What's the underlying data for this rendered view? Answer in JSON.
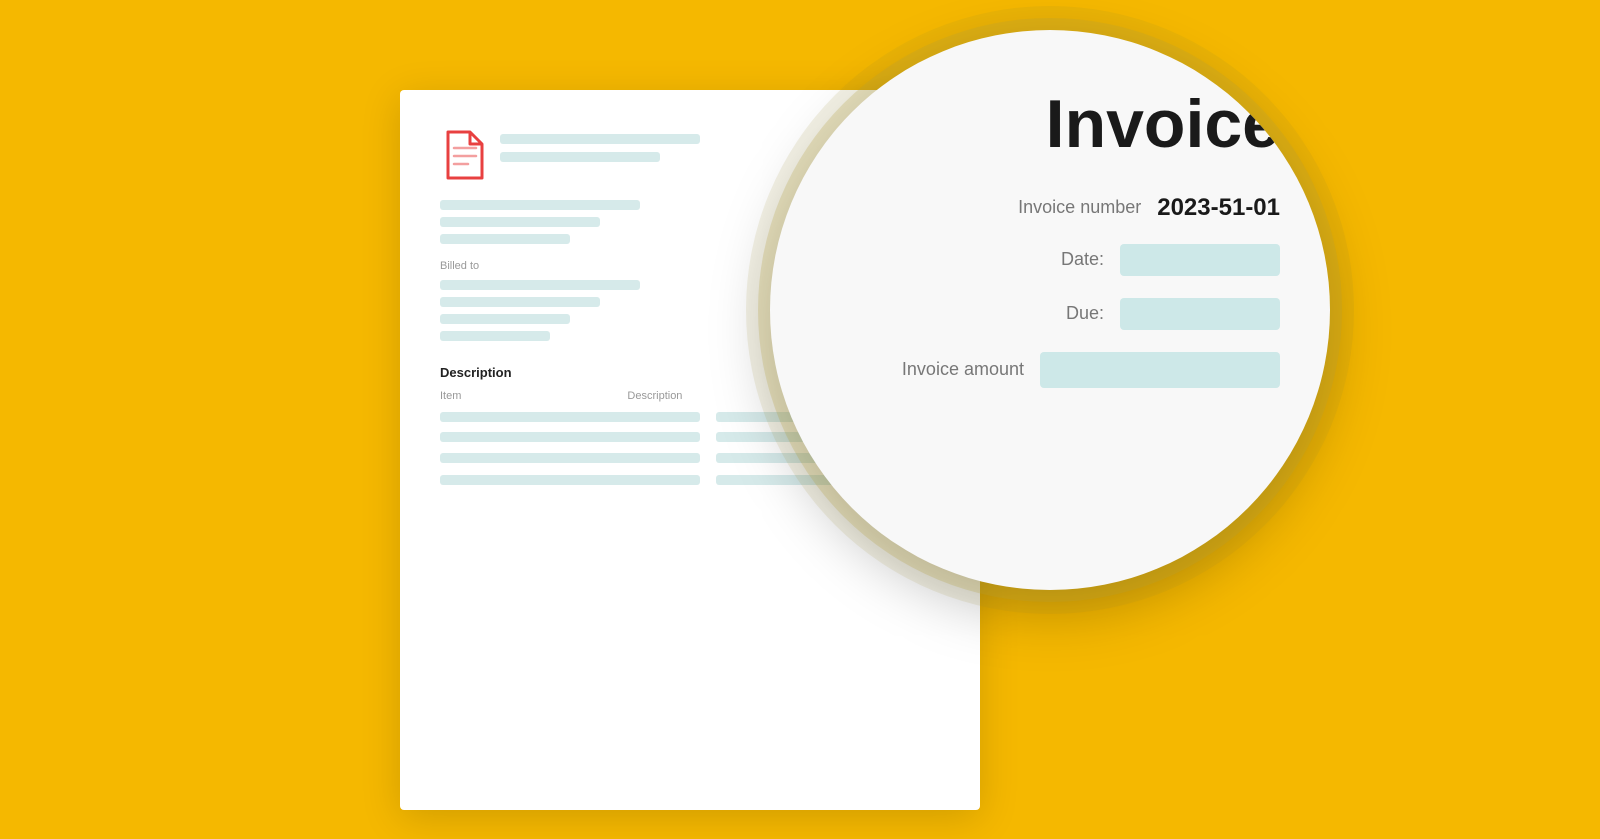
{
  "background_color": "#F5B800",
  "invoice_doc": {
    "billed_to_label": "Billed to",
    "description_label": "Description",
    "item_label": "Item",
    "description_col_label": "Description",
    "dollar_sign": "$"
  },
  "magnifier": {
    "title": "Invoice",
    "number_label": "Invoice number",
    "number_value": "2023-51-01",
    "date_label": "Date:",
    "due_label": "Due:",
    "amount_label": "Invoice amount"
  }
}
